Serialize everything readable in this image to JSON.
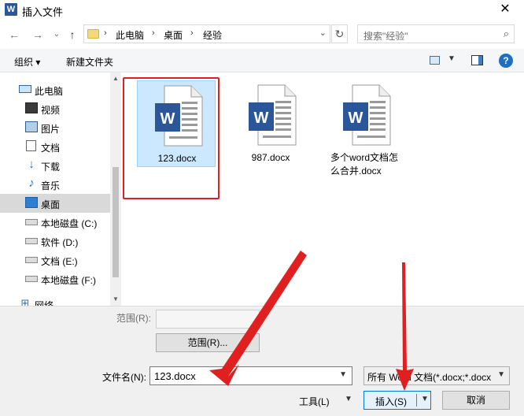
{
  "window": {
    "title": "插入文件",
    "app_icon_letter": "W",
    "close_glyph": "✕"
  },
  "address": {
    "crumbs": [
      "此电脑",
      "桌面",
      "经验"
    ],
    "separator": "›"
  },
  "search": {
    "placeholder": "搜索\"经验\""
  },
  "toolbar": {
    "organize": "组织 ▾",
    "new_folder": "新建文件夹",
    "help": "?"
  },
  "sidebar": {
    "items": [
      {
        "label": "此电脑",
        "icon": "computer-icon"
      },
      {
        "label": "视频",
        "icon": "video-icon"
      },
      {
        "label": "图片",
        "icon": "pictures-icon"
      },
      {
        "label": "文档",
        "icon": "documents-icon"
      },
      {
        "label": "下载",
        "icon": "download-icon"
      },
      {
        "label": "音乐",
        "icon": "music-icon"
      },
      {
        "label": "桌面",
        "icon": "desktop-icon",
        "selected": true
      },
      {
        "label": "本地磁盘 (C:)",
        "icon": "drive-icon"
      },
      {
        "label": "软件 (D:)",
        "icon": "drive-icon"
      },
      {
        "label": "文档 (E:)",
        "icon": "drive-icon"
      },
      {
        "label": "本地磁盘 (F:)",
        "icon": "drive-icon"
      },
      {
        "label": "网络",
        "icon": "network-icon"
      }
    ]
  },
  "files": [
    {
      "name": "123.docx",
      "selected": true
    },
    {
      "name": "987.docx",
      "selected": false
    },
    {
      "name": "多个word文档怎么合并.docx",
      "selected": false
    }
  ],
  "bottom": {
    "range_label": "范围(R):",
    "range_button": "范围(R)...",
    "filename_label": "文件名(N):",
    "filename_value": "123.docx",
    "filter_value": "所有 Word 文档(*.docx;*.docx",
    "tools_label": "工具(L)",
    "insert_label": "插入(S)",
    "cancel_label": "取消"
  },
  "colors": {
    "accent": "#0078d7",
    "word_blue": "#2b579a",
    "annotation_red": "#e02020",
    "selected_bg": "#cce8ff"
  }
}
